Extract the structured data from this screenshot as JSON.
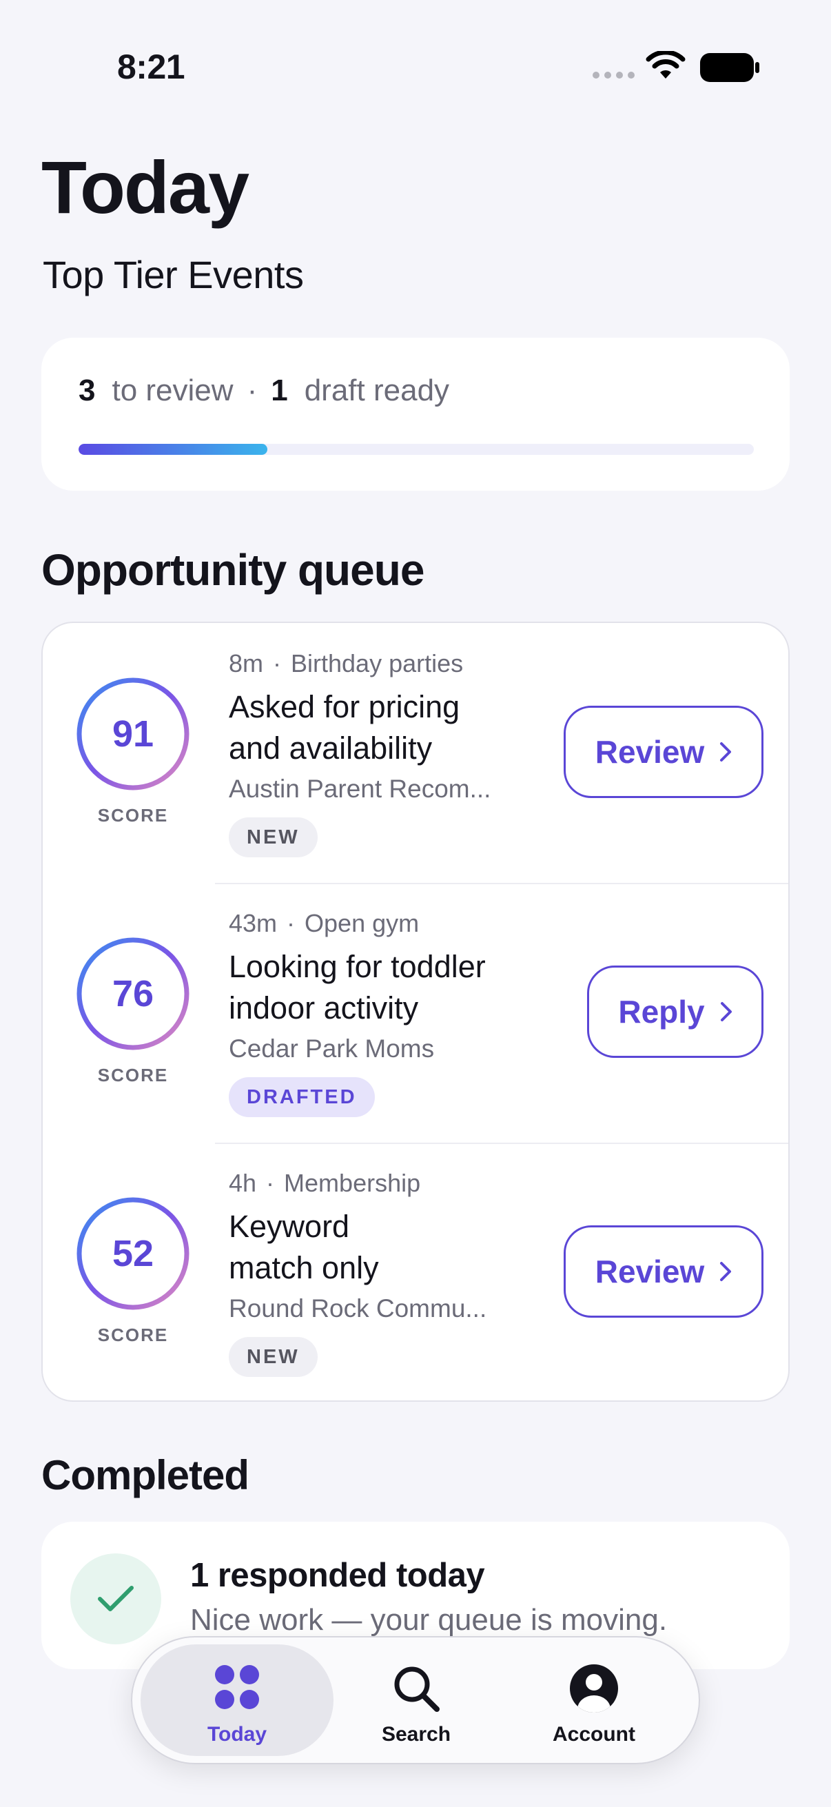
{
  "status_bar": {
    "time": "8:21"
  },
  "header": {
    "title": "Today",
    "subtitle": "Top Tier Events"
  },
  "summary": {
    "review_count": "3",
    "review_label": "to review",
    "separator": "·",
    "draft_count": "1",
    "draft_label": "draft ready",
    "progress": 0.28
  },
  "queue": {
    "title": "Opportunity queue",
    "items": [
      {
        "score": "91",
        "score_label": "SCORE",
        "time": "8m",
        "sep": "·",
        "category": "Birthday parties",
        "title": "Asked for pricing and availability",
        "source": "Austin Parent Recom...",
        "badge": "NEW",
        "action": "Review"
      },
      {
        "score": "76",
        "score_label": "SCORE",
        "time": "43m",
        "sep": "·",
        "category": "Open gym",
        "title": "Looking for toddler indoor activity",
        "source": "Cedar Park Moms",
        "badge": "DRAFTED",
        "action": "Reply"
      },
      {
        "score": "52",
        "score_label": "SCORE",
        "time": "4h",
        "sep": "·",
        "category": "Membership",
        "title": "Keyword match only",
        "source": "Round Rock Commu...",
        "badge": "NEW",
        "action": "Review"
      }
    ]
  },
  "completed": {
    "title": "Completed",
    "card_title": "1 responded today",
    "card_subtitle": "Nice work — your queue is moving."
  },
  "tab_bar": {
    "tabs": [
      {
        "label": "Today",
        "icon": "grid-dots-icon"
      },
      {
        "label": "Search",
        "icon": "magnifier-icon"
      },
      {
        "label": "Account",
        "icon": "person-circle-icon"
      }
    ],
    "active": "Today"
  },
  "colors": {
    "accent": "#5a46d6",
    "progress_start": "#5a4ae3",
    "progress_end": "#3ab4ec",
    "success": "#2f9e6e"
  }
}
